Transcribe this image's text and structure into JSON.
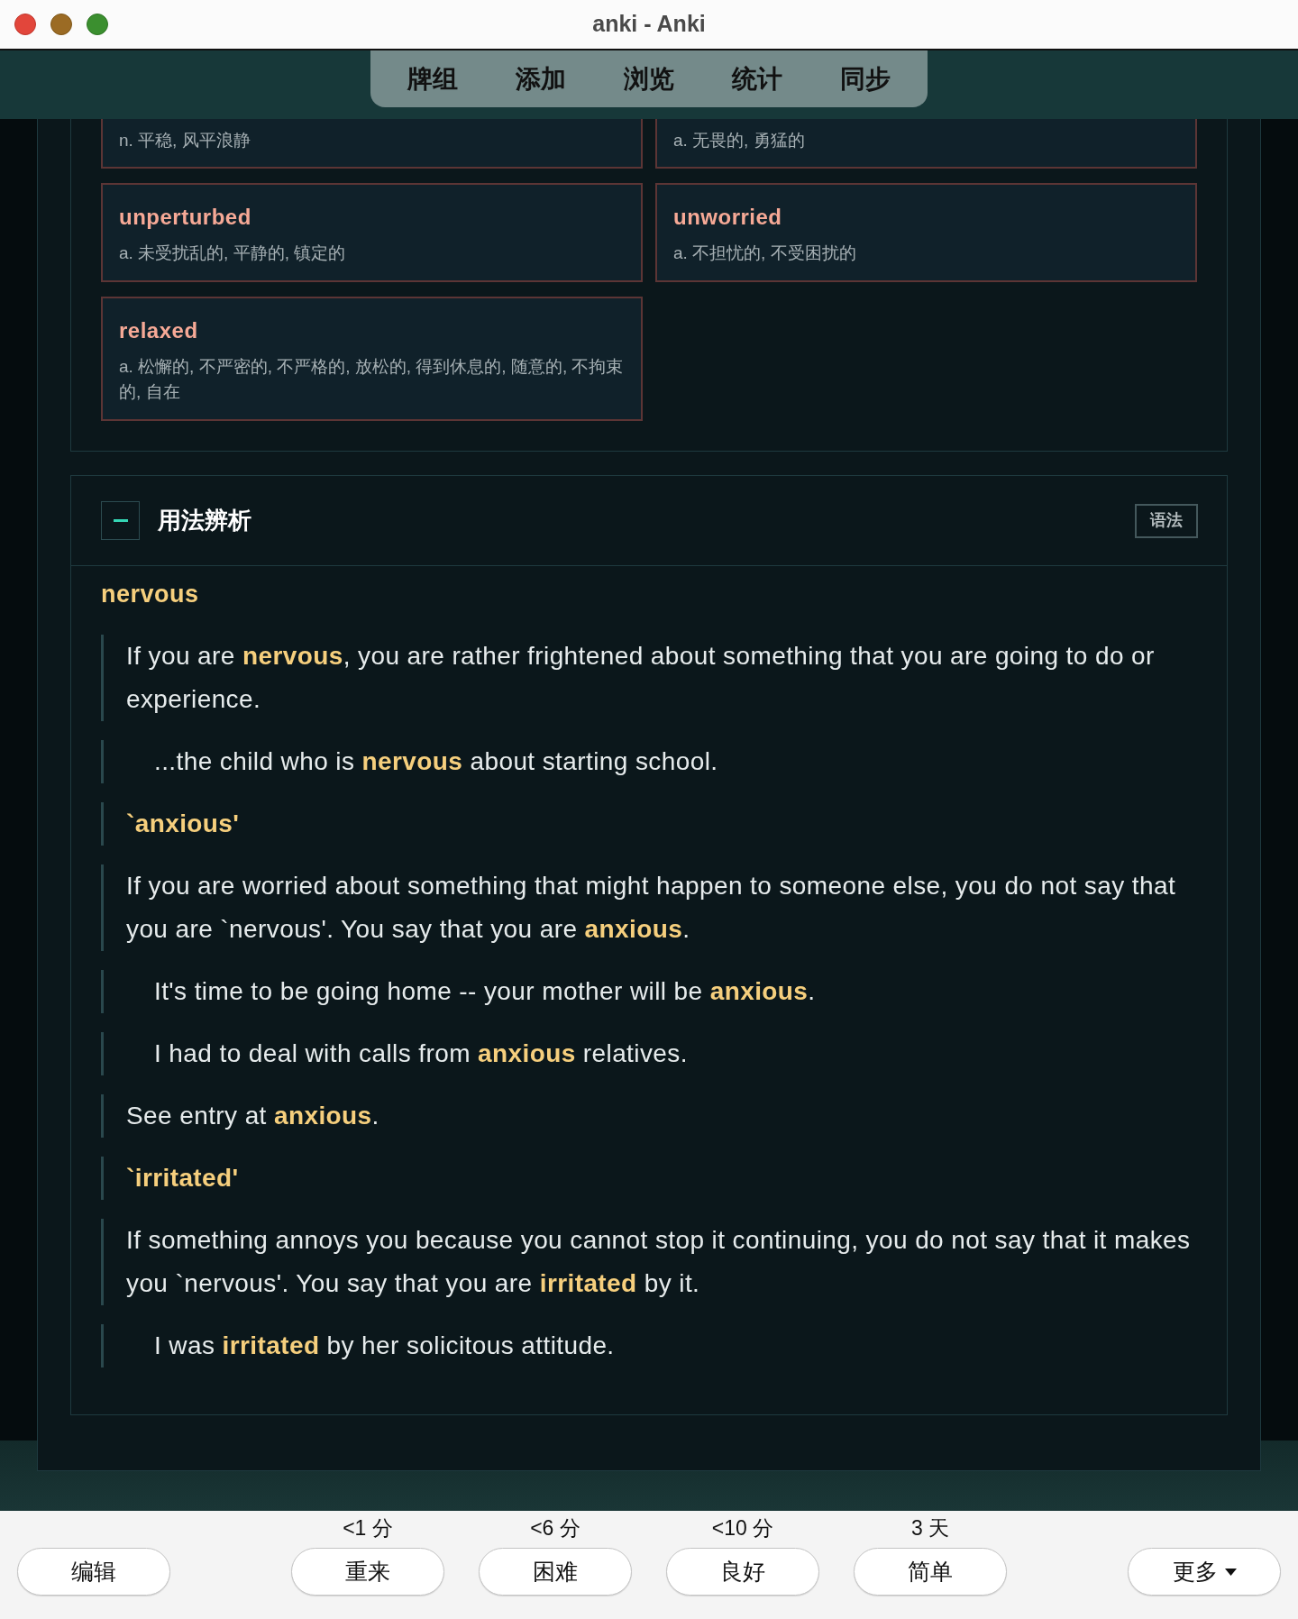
{
  "window": {
    "title": "anki - Anki"
  },
  "top_nav": {
    "items": [
      {
        "label": "牌组"
      },
      {
        "label": "添加"
      },
      {
        "label": "浏览"
      },
      {
        "label": "统计"
      },
      {
        "label": "同步"
      }
    ]
  },
  "synonyms": {
    "cards": [
      {
        "definition": "n. 平稳, 风平浪静"
      },
      {
        "definition": "a. 无畏的, 勇猛的"
      },
      {
        "word": "unperturbed",
        "definition": "a. 未受扰乱的, 平静的, 镇定的"
      },
      {
        "word": "unworried",
        "definition": "a. 不担忧的, 不受困扰的"
      },
      {
        "word": "relaxed",
        "definition": "a. 松懈的, 不严密的, 不严格的, 放松的, 得到休息的, 随意的, 不拘束的, 自在"
      }
    ]
  },
  "usage_section": {
    "expanded": true,
    "title": "用法辨析",
    "tag": "语法",
    "headword": "nervous",
    "entries": [
      {
        "kind": "definition",
        "text": "If you are **nervous**, you are rather frightened about something that you are going to do or experience."
      },
      {
        "kind": "example",
        "text": "...the child who is **nervous** about starting school."
      },
      {
        "kind": "heading",
        "text": "`anxious'"
      },
      {
        "kind": "definition",
        "text": "If you are worried about something that might happen to someone else, you do not say that you are `nervous'. You say that you are **anxious**."
      },
      {
        "kind": "example",
        "text": "It's time to be going home -- your mother will be **anxious**."
      },
      {
        "kind": "example",
        "text": "I had to deal with calls from **anxious** relatives."
      },
      {
        "kind": "definition",
        "text": "See entry at **anxious**."
      },
      {
        "kind": "heading",
        "text": "`irritated'"
      },
      {
        "kind": "definition",
        "text": "If something annoys you because you cannot stop it continuing, you do not say that it makes you `nervous'. You say that you are **irritated** by it."
      },
      {
        "kind": "example",
        "text": "I was **irritated** by her solicitous attitude."
      }
    ]
  },
  "answer_bar": {
    "left_button": {
      "label": "编辑"
    },
    "answer_buttons": [
      {
        "interval": "<1 分",
        "label": "重来"
      },
      {
        "interval": "<6 分",
        "label": "困难"
      },
      {
        "interval": "<10 分",
        "label": "良好"
      },
      {
        "interval": "3 天",
        "label": "简单"
      }
    ],
    "right_button": {
      "label": "更多",
      "dropdown": true
    }
  }
}
